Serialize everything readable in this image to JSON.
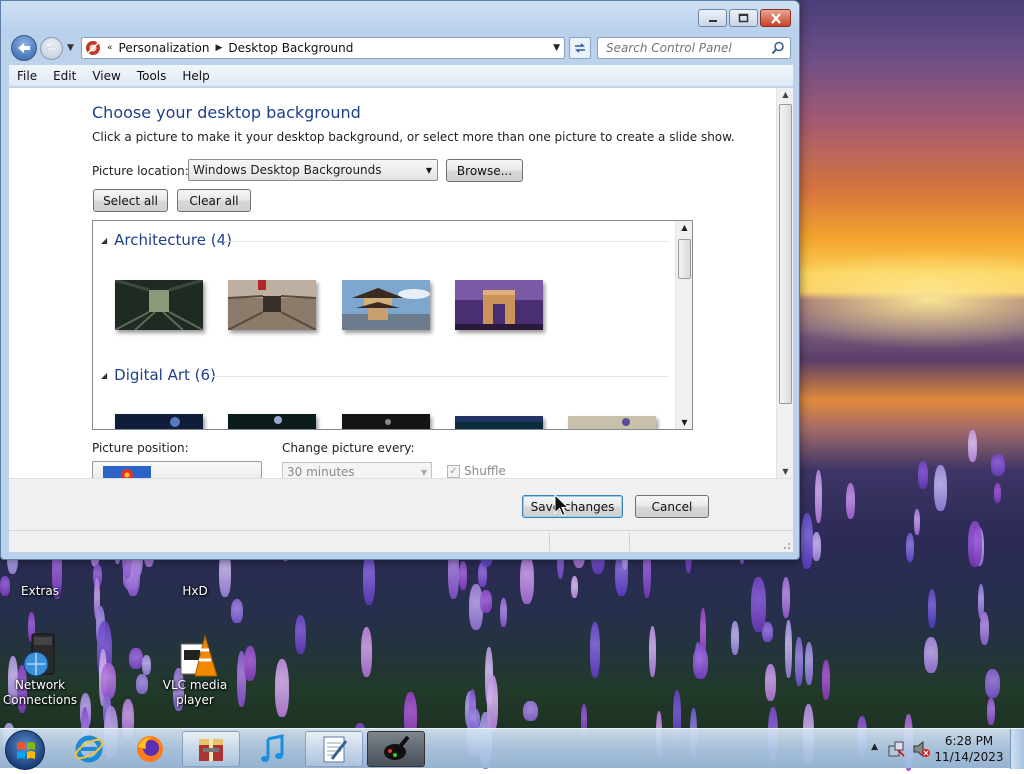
{
  "window": {
    "address": {
      "parent": "Personalization",
      "current": "Desktop Background"
    },
    "search": {
      "placeholder": "Search Control Panel"
    },
    "menu": [
      "File",
      "Edit",
      "View",
      "Tools",
      "Help"
    ]
  },
  "page": {
    "title": "Choose your desktop background",
    "subtitle": "Click a picture to make it your desktop background, or select more than one picture to create a slide show.",
    "picture_location": {
      "label": "Picture location:",
      "value": "Windows Desktop Backgrounds",
      "browse_label": "Browse..."
    },
    "select_all_label": "Select all",
    "clear_all_label": "Clear all",
    "groups": [
      {
        "name": "Architecture (4)",
        "thumbs": [
          "tunnel",
          "hall",
          "pagoda",
          "arch"
        ]
      },
      {
        "name": "Digital Art (6)",
        "thumbs": [
          "art1",
          "art2",
          "art3",
          "art4",
          "art5"
        ]
      }
    ],
    "picture_position_label": "Picture position:",
    "change_every_label": "Change picture every:",
    "change_every_value": "30 minutes",
    "shuffle_label": "Shuffle",
    "save_label": "Save changes",
    "cancel_label": "Cancel"
  },
  "desktop_icons": [
    {
      "label": "Extras"
    },
    {
      "label": "HxD"
    },
    {
      "label": "Network Connections"
    },
    {
      "label": "VLC media player"
    }
  ],
  "taskbar": {
    "time": "6:28 PM",
    "date": "11/14/2023",
    "items": [
      "internet-explorer",
      "firefox",
      "archive-manager",
      "itunes",
      "notepad",
      "paint"
    ]
  },
  "colors": {
    "heading_blue": "#1e3f8c",
    "window_frame": "#bcd2ea"
  }
}
